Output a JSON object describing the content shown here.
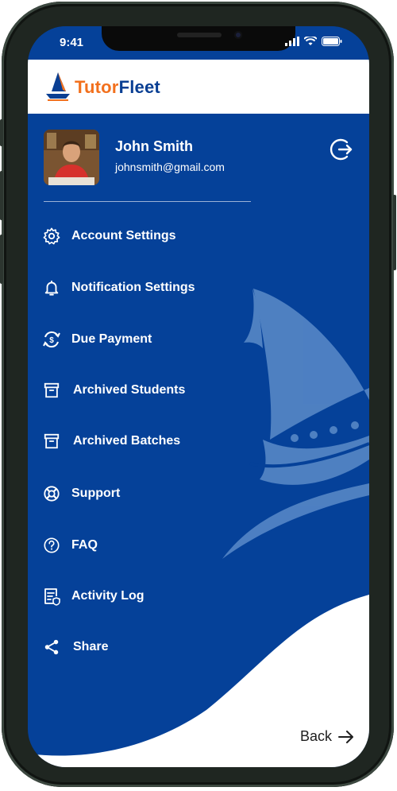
{
  "status_bar": {
    "time": "9:41"
  },
  "app": {
    "logo_part1": "Tutor",
    "logo_part2": "Fleet"
  },
  "profile": {
    "name": "John Smith",
    "email": "johnsmith@gmail.com"
  },
  "menu": {
    "items": [
      {
        "label": "Account Settings",
        "icon": "gear-icon"
      },
      {
        "label": "Notification Settings",
        "icon": "bell-icon"
      },
      {
        "label": "Due Payment",
        "icon": "dollar-refresh-icon"
      },
      {
        "label": "Archived Students",
        "icon": "archive-box-icon"
      },
      {
        "label": "Archived Batches",
        "icon": "archive-box-icon"
      },
      {
        "label": "Support",
        "icon": "lifebuoy-icon"
      },
      {
        "label": "FAQ",
        "icon": "question-icon"
      },
      {
        "label": "Activity Log",
        "icon": "activity-log-icon"
      },
      {
        "label": "Share",
        "icon": "share-icon"
      }
    ]
  },
  "footer": {
    "back_label": "Back"
  },
  "colors": {
    "primary": "#054199",
    "accent": "#f2701d",
    "sail": "#5b8bc9"
  }
}
